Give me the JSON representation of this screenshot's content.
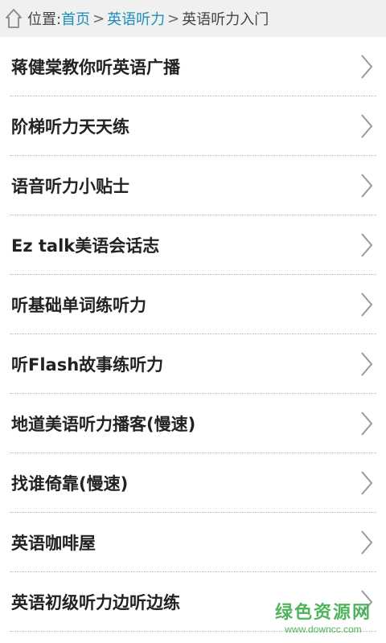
{
  "breadcrumb": {
    "prefix": "位置:",
    "links": [
      "首页",
      "英语听力"
    ],
    "separator": ">",
    "current": "英语听力入门"
  },
  "list": {
    "items": [
      "蒋健棠教你听英语广播",
      "阶梯听力天天练",
      "语音听力小贴士",
      "Ez talk美语会话志",
      "听基础单词练听力",
      "听Flash故事练听力",
      "地道美语听力播客(慢速)",
      "找谁倚靠(慢速)",
      "英语咖啡屋",
      "英语初级听力边听边练"
    ]
  },
  "watermark": {
    "main": "绿色资源网",
    "url": "www.downcc.com"
  },
  "icons": {
    "home": "home-icon",
    "chevron": "chevron-right-icon"
  },
  "colors": {
    "link": "#1a8fb8",
    "header_bg": "#f0f0f0",
    "watermark": "#3dae4c"
  }
}
